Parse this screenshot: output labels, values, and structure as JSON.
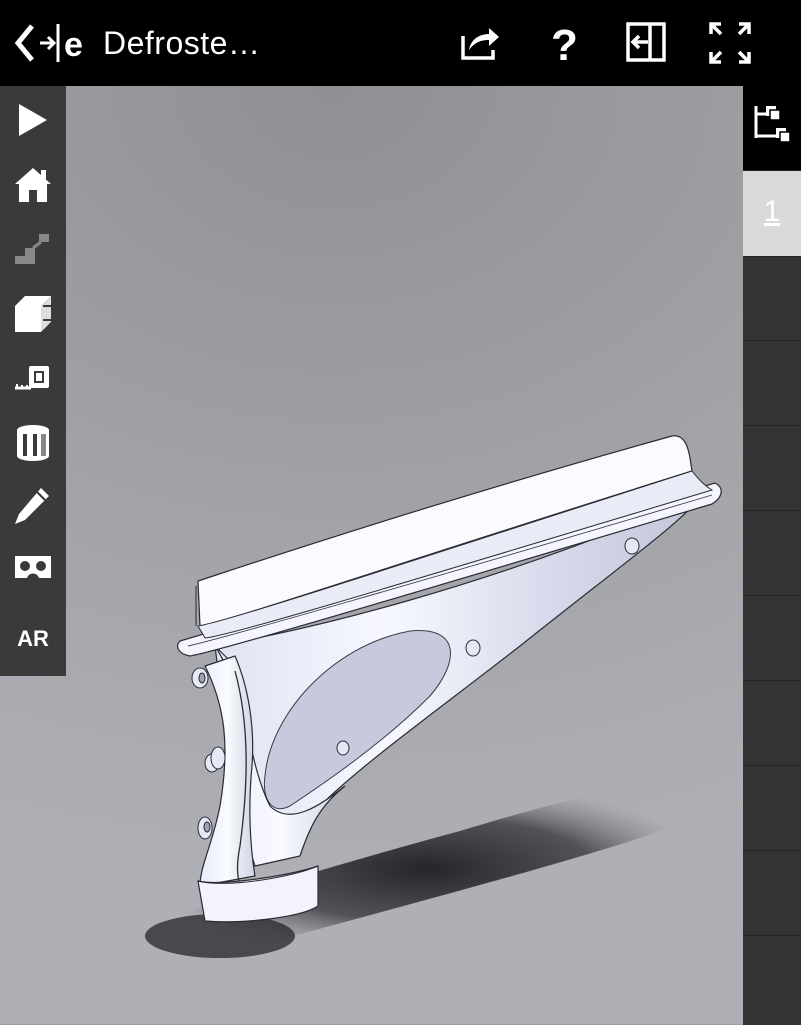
{
  "app": {
    "title": "Defroste…",
    "logo_icon": "back-to-edrawings-icon"
  },
  "toolbar": {
    "share_icon": "share-icon",
    "help_icon": "help-icon",
    "exit_view_icon": "exit-panel-icon",
    "fullscreen_icon": "fullscreen-icon"
  },
  "left_tools": [
    {
      "name": "play-icon"
    },
    {
      "name": "home-icon"
    },
    {
      "name": "steps-icon"
    },
    {
      "name": "section-view-icon"
    },
    {
      "name": "measure-icon"
    },
    {
      "name": "display-style-icon"
    },
    {
      "name": "markup-icon"
    },
    {
      "name": "vr-headset-icon"
    },
    {
      "name": "ar-button",
      "label": "AR"
    }
  ],
  "right_panel": {
    "tree_icon": "component-tree-icon",
    "sheets": [
      {
        "label": "1",
        "selected": true
      }
    ]
  },
  "colors": {
    "bar": "#000000",
    "panel": "#3a3a3a",
    "selected_sheet": "#d9d9d9",
    "model": "#eef0fb"
  }
}
